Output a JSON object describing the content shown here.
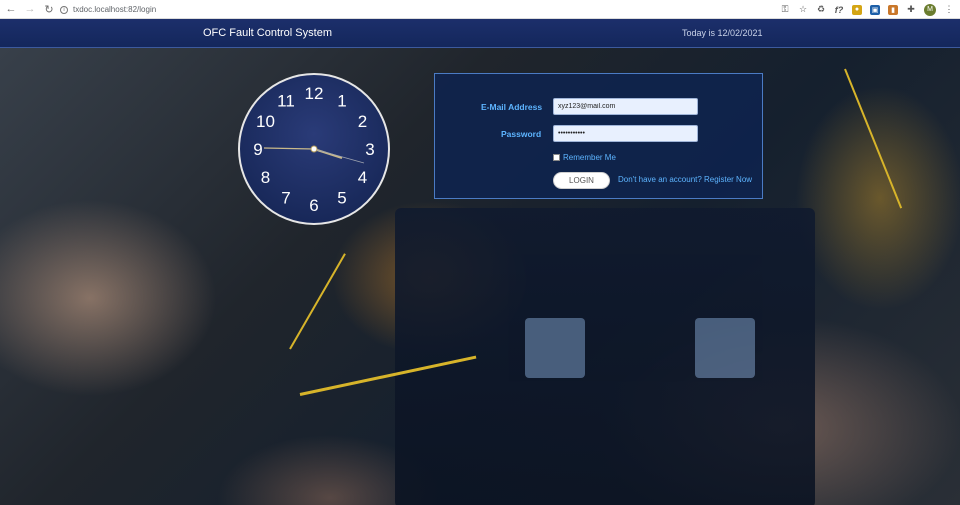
{
  "browser": {
    "url": "txdoc.localhost:82/login",
    "avatar_letter": "M",
    "ext_f": "f?"
  },
  "header": {
    "title": "OFC Fault Control System",
    "date": "Today is 12/02/2021"
  },
  "clock": {
    "numbers": [
      "12",
      "1",
      "2",
      "3",
      "4",
      "5",
      "6",
      "7",
      "8",
      "9",
      "10",
      "11"
    ]
  },
  "login": {
    "email_label": "E-Mail Address",
    "email_value": "xyz123@mail.com",
    "password_label": "Password",
    "password_value": "•••••••••••",
    "remember_label": "Remember Me",
    "login_button": "LOGIN",
    "register_link": "Don't have an account? Register Now"
  },
  "colors": {
    "header_bg": "#1c2f6b",
    "label_blue": "#5db4ff",
    "panel_border": "#4b7bc4"
  }
}
